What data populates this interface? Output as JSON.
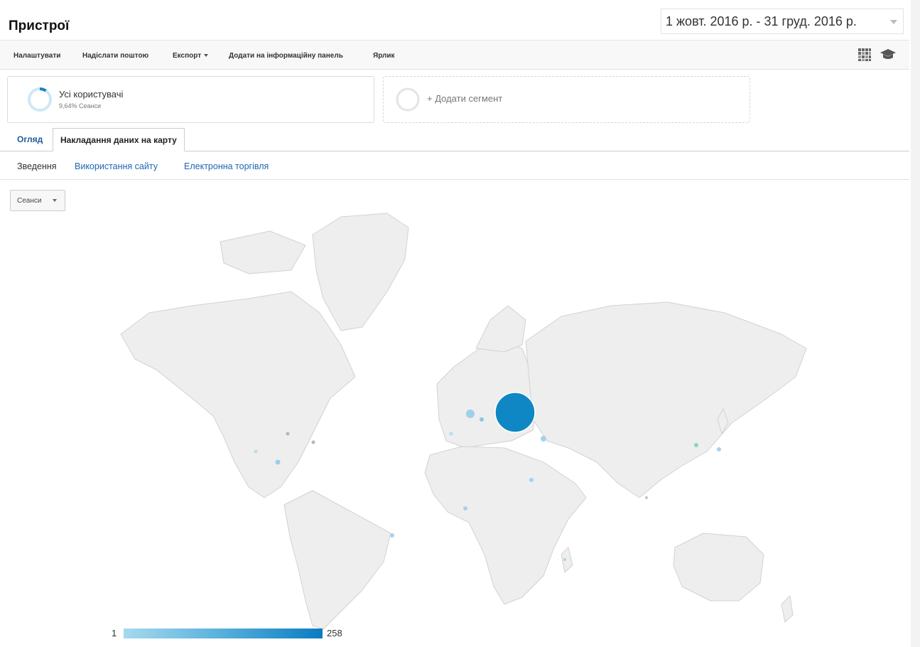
{
  "header": {
    "title": "Пристрої",
    "date_range": "1 жовт. 2016 р. - 31 груд. 2016 р."
  },
  "toolbar": {
    "customize": "Налаштувати",
    "email": "Надіслати поштою",
    "export": "Експорт",
    "add_to_dashboard": "Додати на інформаційну панель",
    "shortcut": "Ярлик"
  },
  "segments": {
    "active": {
      "name": "Усі користувачі",
      "detail": "9,64% Сеанси",
      "ring_fraction": 0.0964
    },
    "add_label": "+ Додати сегмент"
  },
  "tabs": [
    {
      "label": "Огляд"
    },
    {
      "label": "Накладання даних на карту"
    }
  ],
  "subnav": [
    {
      "label": "Зведення"
    },
    {
      "label": "Використання сайту"
    },
    {
      "label": "Електронна торгівля"
    }
  ],
  "metric_selector": {
    "value": "Сеанси"
  },
  "map_legend": {
    "min": "1",
    "max": "258"
  },
  "colors": {
    "accent": "#1f66b0",
    "legend_low": "#a7d9ed",
    "legend_high": "#0a7cc2",
    "land": "#eeeeee"
  },
  "icons": {
    "grid": "grid-icon",
    "education": "graduation-cap-icon"
  }
}
